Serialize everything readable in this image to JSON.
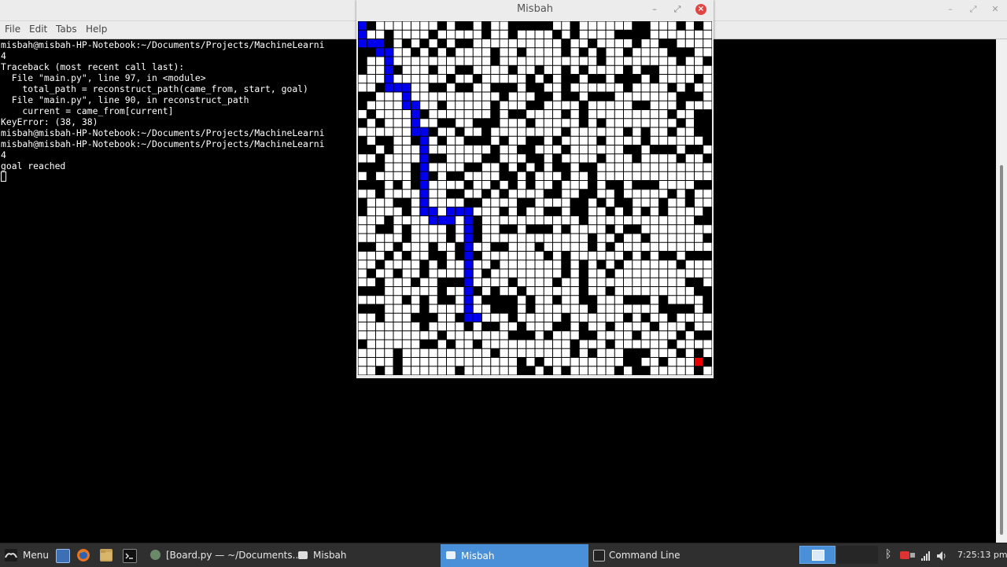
{
  "terminal": {
    "title": "",
    "menu": [
      "File",
      "Edit",
      "Tabs",
      "Help"
    ],
    "lines": [
      "misbah@misbah-HP-Notebook:~/Documents/Projects/MachineLearni",
      "4",
      "Traceback (most recent call last):",
      "  File \"main.py\", line 97, in <module>",
      "    total_path = reconstruct_path(came_from, start, goal)",
      "  File \"main.py\", line 90, in reconstruct_path",
      "    current = came_from[current]",
      "KeyError: (38, 38)",
      "misbah@misbah-HP-Notebook:~/Documents/Projects/MachineLearni",
      "misbah@misbah-HP-Notebook:~/Documents/Projects/MachineLearni",
      "4",
      "goal reached"
    ]
  },
  "game_window": {
    "title": "Misbah",
    "grid": {
      "cols": 40,
      "rows": 40,
      "wall_color": "#000000",
      "open_color": "#ffffff",
      "path_color": "#0000ee",
      "goal_color": "#ee0000",
      "goal_cell": [
        38,
        38
      ],
      "path": [
        [
          0,
          0
        ],
        [
          0,
          1
        ],
        [
          0,
          2
        ],
        [
          1,
          2
        ],
        [
          2,
          2
        ],
        [
          2,
          3
        ],
        [
          3,
          3
        ],
        [
          3,
          4
        ],
        [
          3,
          5
        ],
        [
          3,
          6
        ],
        [
          3,
          7
        ],
        [
          4,
          7
        ],
        [
          5,
          7
        ],
        [
          5,
          8
        ],
        [
          5,
          9
        ],
        [
          6,
          9
        ],
        [
          6,
          10
        ],
        [
          6,
          11
        ],
        [
          6,
          12
        ],
        [
          7,
          12
        ],
        [
          7,
          13
        ],
        [
          7,
          14
        ],
        [
          7,
          15
        ],
        [
          7,
          16
        ],
        [
          7,
          17
        ],
        [
          7,
          18
        ],
        [
          7,
          19
        ],
        [
          7,
          20
        ],
        [
          7,
          21
        ],
        [
          8,
          21
        ],
        [
          8,
          22
        ],
        [
          9,
          22
        ],
        [
          10,
          22
        ],
        [
          10,
          21
        ],
        [
          11,
          21
        ],
        [
          12,
          21
        ],
        [
          12,
          22
        ],
        [
          12,
          23
        ],
        [
          12,
          24
        ],
        [
          12,
          25
        ],
        [
          12,
          26
        ],
        [
          12,
          27
        ],
        [
          12,
          28
        ],
        [
          12,
          29
        ],
        [
          12,
          30
        ],
        [
          12,
          31
        ],
        [
          12,
          32
        ],
        [
          12,
          33
        ],
        [
          13,
          33
        ]
      ]
    }
  },
  "taskbar": {
    "menu_label": "Menu",
    "tasks": [
      {
        "label": "[Board.py — ~/Documents...",
        "active": false
      },
      {
        "label": "Misbah",
        "active": false
      },
      {
        "label": "Misbah",
        "active": true
      },
      {
        "label": "Command Line",
        "active": false
      }
    ],
    "clock": "7:25:13 pm",
    "accent": "#4a90d9"
  }
}
